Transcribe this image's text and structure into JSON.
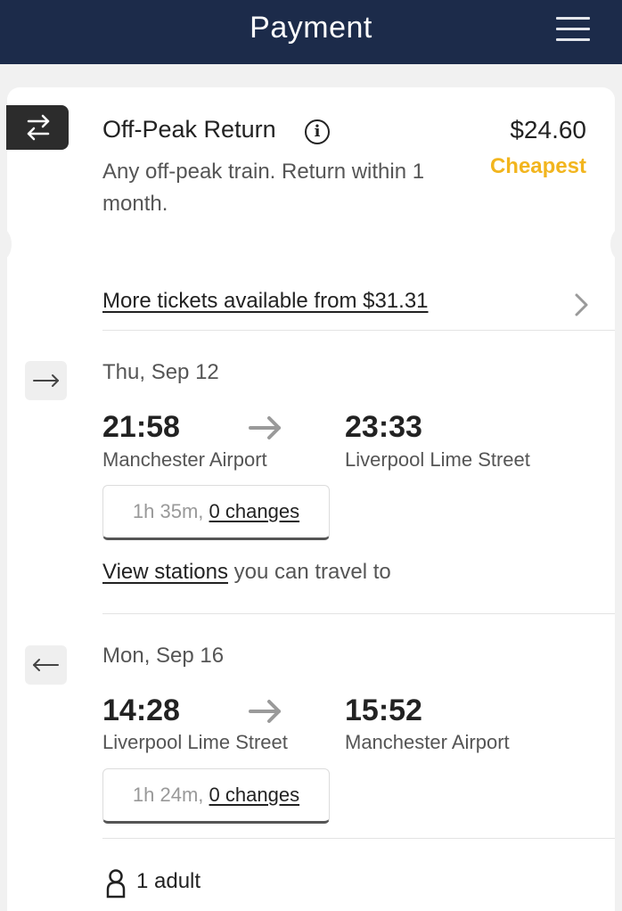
{
  "header": {
    "title": "Payment",
    "menu_icon": "hamburger-menu-icon",
    "background": "#1c2b4a"
  },
  "ticket": {
    "type_icon": "swap-arrows-icon",
    "name": "Off-Peak Return",
    "info_icon": "info-icon",
    "price": "$24.60",
    "description": "Any off-peak train. Return within 1 month.",
    "badge": "Cheapest",
    "badge_color": "#f2b51e"
  },
  "more_tickets": {
    "label": "More tickets available from $31.31",
    "icon": "chevron-right-icon"
  },
  "outbound": {
    "direction_icon": "arrow-right-icon",
    "date": "Thu, Sep 12",
    "depart_time": "21:58",
    "arrive_time": "23:33",
    "from_station": "Manchester Airport",
    "to_station": "Liverpool Lime Street",
    "duration": "1h 35m,",
    "changes": "0 changes"
  },
  "view_stations": {
    "link": "View stations",
    "rest": " you can travel to"
  },
  "return": {
    "direction_icon": "arrow-left-icon",
    "date": "Mon, Sep 16",
    "depart_time": "14:28",
    "arrive_time": "15:52",
    "from_station": "Liverpool Lime Street",
    "to_station": "Manchester Airport",
    "duration": "1h 24m,",
    "changes": "0 changes"
  },
  "passengers": {
    "icon": "person-icon",
    "label": "1 adult"
  }
}
